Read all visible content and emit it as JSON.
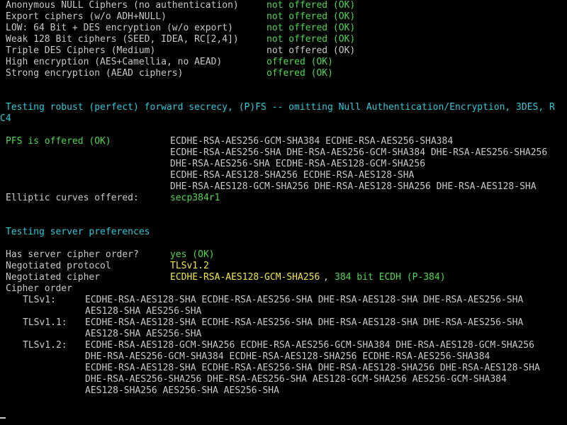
{
  "cipher_categories": [
    {
      "label": "Anonymous NULL Ciphers (no authentication)",
      "status": "not offered (OK)",
      "status_color": "green"
    },
    {
      "label": "Export ciphers (w/o ADH+NULL)",
      "status": "not offered (OK)",
      "status_color": "green"
    },
    {
      "label": "LOW: 64 Bit + DES encryption (w/o export)",
      "status": "not offered (OK)",
      "status_color": "green"
    },
    {
      "label": "Weak 128 Bit ciphers (SEED, IDEA, RC[2,4])",
      "status": "not offered (OK)",
      "status_color": "green"
    },
    {
      "label": "Triple DES Ciphers (Medium)",
      "status": "not offered (OK)",
      "status_color": "gray"
    },
    {
      "label": "High encryption (AES+Camellia, no AEAD)",
      "status": "offered (OK)",
      "status_color": "green"
    },
    {
      "label": "Strong encryption (AEAD ciphers)",
      "status": "offered (OK)",
      "status_color": "green"
    }
  ],
  "pfs_section": {
    "heading_line1": "Testing robust (perfect) forward secrecy, (P)FS -- omitting Null Authentication/Encryption, 3DES, R",
    "heading_line2": "C4",
    "pfs_label": "PFS is offered (OK)",
    "pfs_ciphers": [
      "ECDHE-RSA-AES256-GCM-SHA384 ECDHE-RSA-AES256-SHA384",
      "ECDHE-RSA-AES256-SHA DHE-RSA-AES256-GCM-SHA384 DHE-RSA-AES256-SHA256",
      "DHE-RSA-AES256-SHA ECDHE-RSA-AES128-GCM-SHA256",
      "ECDHE-RSA-AES128-SHA256 ECDHE-RSA-AES128-SHA",
      "DHE-RSA-AES128-GCM-SHA256 DHE-RSA-AES128-SHA256 DHE-RSA-AES128-SHA"
    ],
    "curves_label": "Elliptic curves offered:",
    "curves_value": "secp384r1"
  },
  "pref_section": {
    "heading": "Testing server preferences",
    "cipher_order_label": "Has server cipher order?",
    "cipher_order_value": "yes (OK)",
    "protocol_label": "Negotiated protocol",
    "protocol_value": "TLSv1.2",
    "cipher_label": "Negotiated cipher",
    "cipher_value": "ECDHE-RSA-AES128-GCM-SHA256",
    "cipher_sep": ", ",
    "cipher_extra": "384 bit ECDH (P-384)",
    "order_label": "Cipher order",
    "order": [
      {
        "version": "TLSv1:",
        "lines": [
          "ECDHE-RSA-AES128-SHA ECDHE-RSA-AES256-SHA DHE-RSA-AES128-SHA DHE-RSA-AES256-SHA",
          "AES128-SHA AES256-SHA"
        ]
      },
      {
        "version": "TLSv1.1:",
        "lines": [
          "ECDHE-RSA-AES128-SHA ECDHE-RSA-AES256-SHA DHE-RSA-AES128-SHA DHE-RSA-AES256-SHA",
          "AES128-SHA AES256-SHA"
        ]
      },
      {
        "version": "TLSv1.2:",
        "lines": [
          "ECDHE-RSA-AES128-GCM-SHA256 ECDHE-RSA-AES256-GCM-SHA384 DHE-RSA-AES128-GCM-SHA256",
          "DHE-RSA-AES256-GCM-SHA384 ECDHE-RSA-AES128-SHA256 ECDHE-RSA-AES256-SHA384",
          "ECDHE-RSA-AES128-SHA ECDHE-RSA-AES256-SHA DHE-RSA-AES128-SHA256 DHE-RSA-AES128-SHA",
          "DHE-RSA-AES256-SHA256 DHE-RSA-AES256-SHA AES128-GCM-SHA256 AES256-GCM-SHA384",
          "AES128-SHA256 AES256-SHA AES256-SHA"
        ]
      }
    ]
  },
  "colors": {
    "background": "#000000",
    "text": "#c8c8c8",
    "green": "#4fd84f",
    "cyan": "#2fc8d8",
    "yellow": "#f0e83c"
  }
}
